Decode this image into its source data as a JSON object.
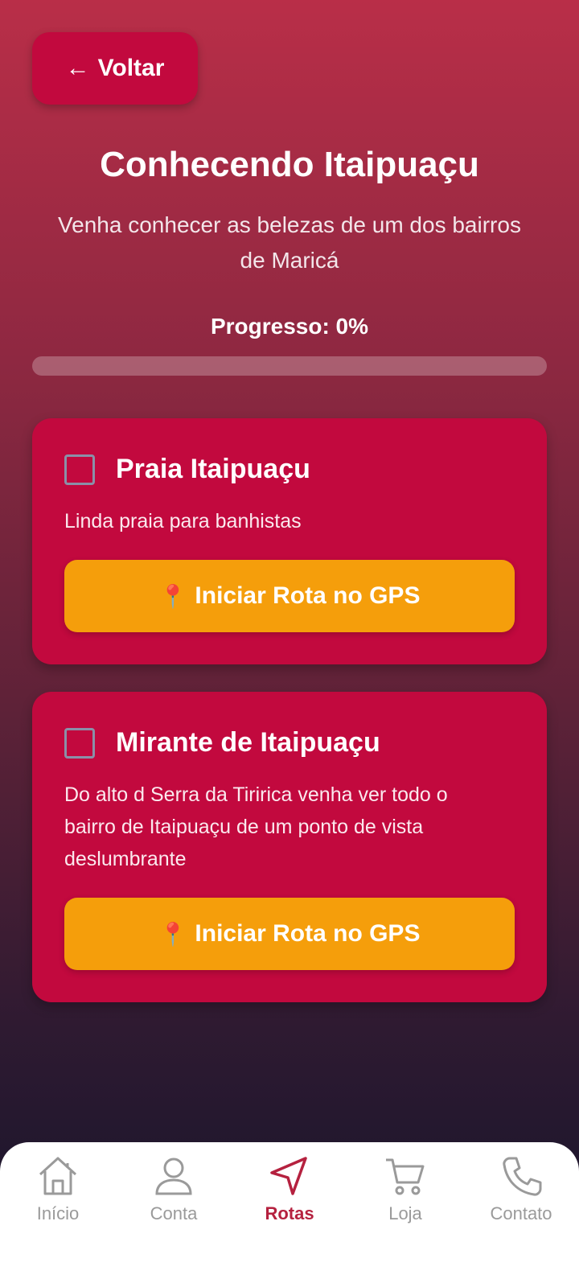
{
  "header": {
    "back_label": "Voltar",
    "title": "Conhecendo Itaipuaçu",
    "subtitle": "Venha conhecer as belezas de um dos bairros de Maricá"
  },
  "progress": {
    "label": "Progresso: 0%",
    "value": 0
  },
  "places": [
    {
      "title": "Praia Itaipuaçu",
      "description": "Linda praia para banhistas",
      "checked": false,
      "button_label": "Iniciar Rota no GPS"
    },
    {
      "title": "Mirante de Itaipuaçu",
      "description": "Do alto d Serra da Tiririca venha ver todo o bairro de Itaipuaçu de um ponto de vista deslumbrante",
      "checked": false,
      "button_label": "Iniciar Rota no GPS"
    }
  ],
  "nav": {
    "items": [
      {
        "label": "Início",
        "icon": "home-icon",
        "active": false
      },
      {
        "label": "Conta",
        "icon": "user-icon",
        "active": false
      },
      {
        "label": "Rotas",
        "icon": "navigation-icon",
        "active": true
      },
      {
        "label": "Loja",
        "icon": "cart-icon",
        "active": false
      },
      {
        "label": "Contato",
        "icon": "phone-icon",
        "active": false
      }
    ]
  },
  "colors": {
    "card": "#c2093e",
    "button": "#f59e0b",
    "active_nav": "#b5213f",
    "inactive_nav": "#9a9a9a"
  }
}
